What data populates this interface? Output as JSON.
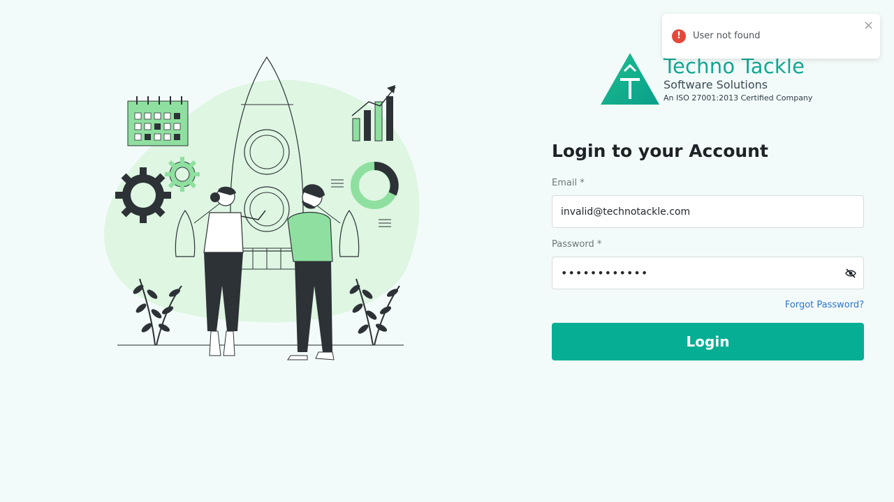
{
  "brand": {
    "title": "Techno Tackle",
    "subtitle": "Software Solutions",
    "certification": "An ISO 27001:2013 Certified Company",
    "registered_mark": "®",
    "accent_color": "#13a791"
  },
  "form": {
    "heading": "Login to your Account",
    "email_label": "Email *",
    "email_value": "invalid@technotackle.com",
    "password_label": "Password *",
    "password_value": "••••••••••••",
    "forgot_password": "Forgot Password?",
    "login_button": "Login",
    "button_color": "#06ae94"
  },
  "toast": {
    "icon": "error-icon",
    "message": "User not found",
    "close_icon": "close-icon",
    "status_color": "#e4483b"
  },
  "illustration": {
    "name": "rocket-launch-team-illustration"
  }
}
